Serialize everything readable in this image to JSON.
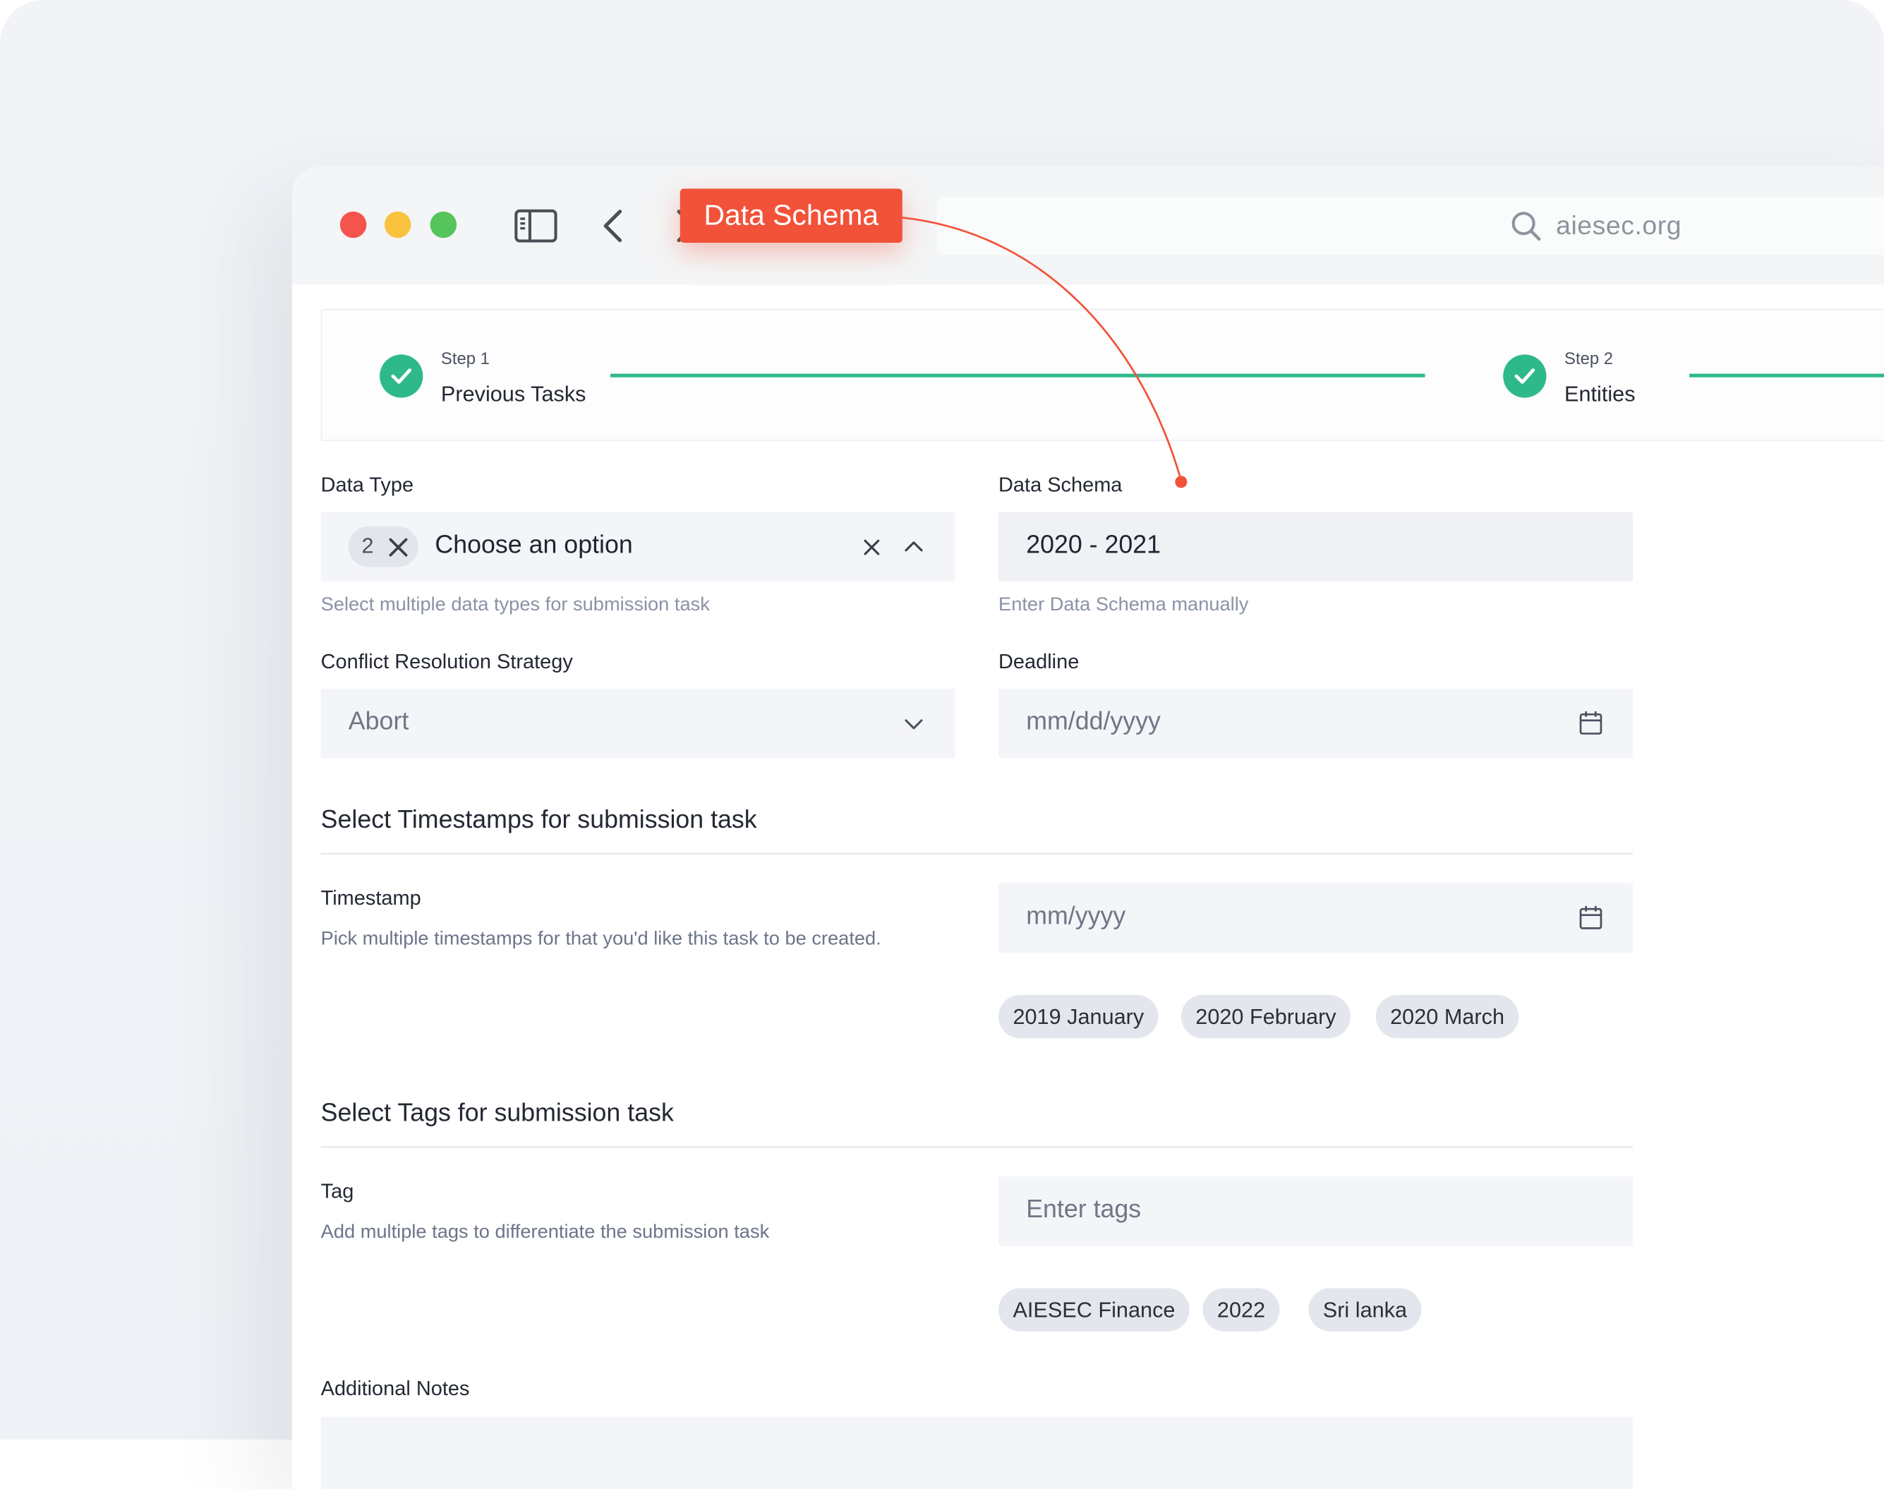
{
  "annotation": {
    "label": "Data Schema"
  },
  "browser": {
    "url": "aiesec.org"
  },
  "stepper": {
    "steps": [
      {
        "step_label": "Step 1",
        "title": "Previous Tasks"
      },
      {
        "step_label": "Step 2",
        "title": "Entities"
      }
    ]
  },
  "form": {
    "data_type": {
      "label": "Data Type",
      "selected_count": "2",
      "placeholder": "Choose an option",
      "hint": "Select multiple data types for submission task"
    },
    "data_schema": {
      "label": "Data Schema",
      "value": "2020 - 2021",
      "hint": "Enter Data Schema manually"
    },
    "conflict_strategy": {
      "label": "Conflict Resolution Strategy",
      "value": "Abort"
    },
    "deadline": {
      "label": "Deadline",
      "placeholder": "mm/dd/yyyy"
    },
    "timestamps_section": {
      "title": "Select Timestamps for submission task",
      "field_label": "Timestamp",
      "hint": "Pick multiple timestamps for that you'd like this task to be created.",
      "placeholder": "mm/yyyy",
      "chips": [
        "2019 January",
        "2020 February",
        "2020 March"
      ]
    },
    "tags_section": {
      "title": "Select Tags for submission task",
      "field_label": "Tag",
      "hint": "Add multiple tags to differentiate the submission task",
      "placeholder": "Enter tags",
      "chips": [
        "AIESEC Finance",
        "2022",
        "Sri lanka"
      ]
    },
    "notes": {
      "label": "Additional Notes"
    }
  },
  "colors": {
    "accent_green": "#2eb98a",
    "annotation_red": "#f2523a",
    "input_bg": "#f4f5f8",
    "chip_bg": "#e3e6ec"
  },
  "icons": [
    "sidebar-icon",
    "back-arrow-icon",
    "search-icon",
    "check-icon",
    "close-icon",
    "chevron-up-icon",
    "chevron-down-icon",
    "calendar-icon"
  ]
}
